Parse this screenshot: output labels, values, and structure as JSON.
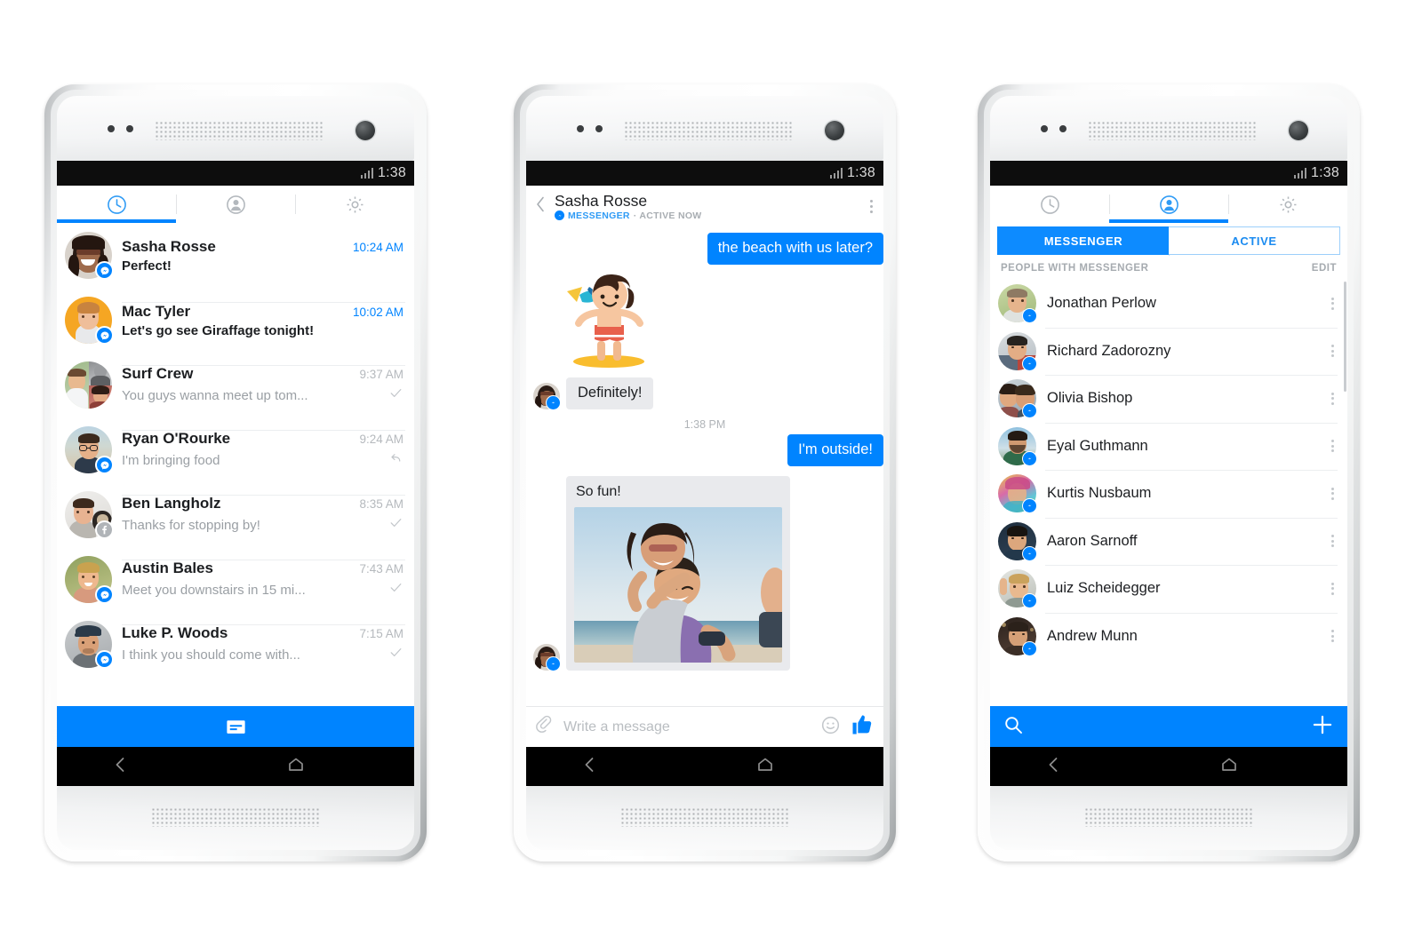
{
  "status_bar": {
    "time": "1:38",
    "signal_icon": "signal-bars-icon"
  },
  "phone1": {
    "name": "messenger-recents-screen",
    "tabs": [
      {
        "id": "recents",
        "icon": "clock-icon",
        "active": true
      },
      {
        "id": "contacts",
        "icon": "person-icon",
        "active": false
      },
      {
        "id": "settings",
        "icon": "gear-icon",
        "active": false
      }
    ],
    "conversations": [
      {
        "name": "Sasha Rosse",
        "snippet": "Perfect!",
        "time": "10:24 AM",
        "unread": true,
        "badge": "messenger",
        "status": "none"
      },
      {
        "name": "Mac Tyler",
        "snippet": "Let's go see Giraffage tonight!",
        "time": "10:02 AM",
        "unread": true,
        "badge": "messenger",
        "status": "none"
      },
      {
        "name": "Surf Crew",
        "snippet": "You guys wanna meet up tom...",
        "time": "9:37 AM",
        "unread": false,
        "badge": "none",
        "status": "check"
      },
      {
        "name": "Ryan O'Rourke",
        "snippet": "I'm bringing food",
        "time": "9:24 AM",
        "unread": false,
        "badge": "messenger",
        "status": "reply"
      },
      {
        "name": "Ben Langholz",
        "snippet": "Thanks for stopping by!",
        "time": "8:35 AM",
        "unread": false,
        "badge": "facebook",
        "status": "check"
      },
      {
        "name": "Austin Bales",
        "snippet": "Meet you downstairs in 15 mi...",
        "time": "7:43 AM",
        "unread": false,
        "badge": "messenger",
        "status": "check"
      },
      {
        "name": "Luke P. Woods",
        "snippet": "I think you should come with...",
        "time": "7:15 AM",
        "unread": false,
        "badge": "messenger",
        "status": "check"
      }
    ],
    "compose": {
      "icon": "compose-message-icon",
      "color": "#0084ff"
    }
  },
  "phone2": {
    "name": "messenger-thread-screen",
    "header": {
      "back_icon": "back-chevron-icon",
      "title": "Sasha Rosse",
      "channel": "MESSENGER",
      "presence": "· ACTIVE NOW",
      "menu_icon": "overflow-menu-icon"
    },
    "messages": [
      {
        "type": "outgoing-text",
        "text": "the beach with us later?"
      },
      {
        "type": "incoming-sticker",
        "sticker": "surfer-sticker"
      },
      {
        "type": "incoming-text",
        "text": "Definitely!"
      },
      {
        "type": "timestamp",
        "text": "1:38 PM"
      },
      {
        "type": "outgoing-text",
        "text": "I'm outside!"
      },
      {
        "type": "incoming-photo",
        "caption": "So fun!",
        "photo": "beach-couple-photo"
      }
    ],
    "input": {
      "attach_icon": "paperclip-icon",
      "placeholder": "Write a message",
      "emoji_icon": "smiley-icon",
      "like_icon": "thumbs-up-icon"
    }
  },
  "phone3": {
    "name": "messenger-contacts-screen",
    "tabs": [
      {
        "id": "recents",
        "icon": "clock-icon",
        "active": false
      },
      {
        "id": "contacts",
        "icon": "person-icon",
        "active": true
      },
      {
        "id": "settings",
        "icon": "gear-icon",
        "active": false
      }
    ],
    "segments": [
      {
        "label": "MESSENGER",
        "active": true
      },
      {
        "label": "ACTIVE",
        "active": false
      }
    ],
    "section": {
      "title": "PEOPLE WITH MESSENGER",
      "action": "EDIT"
    },
    "contacts": [
      {
        "name": "Jonathan Perlow",
        "badge": "messenger"
      },
      {
        "name": "Richard Zadorozny",
        "badge": "messenger"
      },
      {
        "name": "Olivia Bishop",
        "badge": "messenger"
      },
      {
        "name": "Eyal Guthmann",
        "badge": "messenger"
      },
      {
        "name": "Kurtis Nusbaum",
        "badge": "messenger"
      },
      {
        "name": "Aaron Sarnoff",
        "badge": "messenger"
      },
      {
        "name": "Luiz Scheidegger",
        "badge": "messenger"
      },
      {
        "name": "Andrew Munn",
        "badge": "messenger"
      }
    ],
    "bottom_bar": {
      "search_icon": "search-icon",
      "add_icon": "plus-icon",
      "color": "#0084ff"
    }
  },
  "android_nav": {
    "back_icon": "android-back-icon",
    "home_icon": "android-home-icon"
  },
  "colors": {
    "accent": "#0084ff",
    "bubble_in": "#e9eaed",
    "text": "#1c1e21",
    "muted": "#9a9fa4"
  }
}
